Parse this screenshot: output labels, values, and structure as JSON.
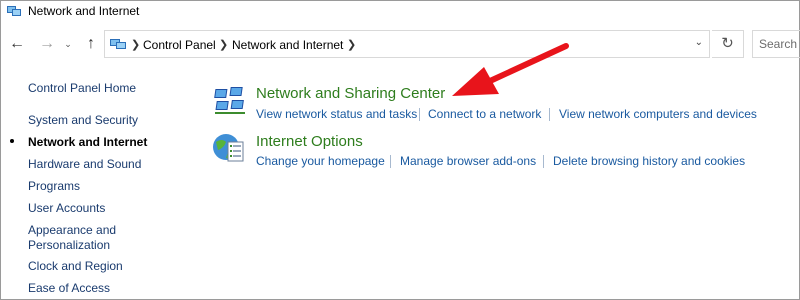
{
  "window": {
    "title": "Network and Internet"
  },
  "navigation": {
    "back": "←",
    "forward": "→",
    "recent": "⌄",
    "up": "↑",
    "breadcrumbs": [
      "Control Panel",
      "Network and Internet"
    ],
    "address_dropdown": "⌄",
    "refresh": "↻",
    "search_placeholder": "Search"
  },
  "sidebar": {
    "items": [
      {
        "label": "Control Panel Home",
        "current": false
      },
      {
        "label": "System and Security",
        "current": false
      },
      {
        "label": "Network and Internet",
        "current": true
      },
      {
        "label": "Hardware and Sound",
        "current": false
      },
      {
        "label": "Programs",
        "current": false
      },
      {
        "label": "User Accounts",
        "current": false
      },
      {
        "label": "Appearance and",
        "current": false
      },
      {
        "label": "Personalization",
        "current": false
      },
      {
        "label": "Clock and Region",
        "current": false
      },
      {
        "label": "Ease of Access",
        "current": false
      }
    ]
  },
  "categories": [
    {
      "title": "Network and Sharing Center",
      "icon": "network-sharing-icon",
      "links": [
        "View network status and tasks",
        "Connect to a network",
        "View network computers and devices"
      ]
    },
    {
      "title": "Internet Options",
      "icon": "internet-options-icon",
      "links": [
        "Change your homepage",
        "Manage browser add-ons",
        "Delete browsing history and cookies"
      ]
    }
  ],
  "annotation": {
    "icon": "red-arrow-icon",
    "color": "#e8141b"
  },
  "colors": {
    "category_title": "#2e7d1d",
    "link": "#1a5aa0",
    "sidebar_link": "#1a3b6e"
  }
}
